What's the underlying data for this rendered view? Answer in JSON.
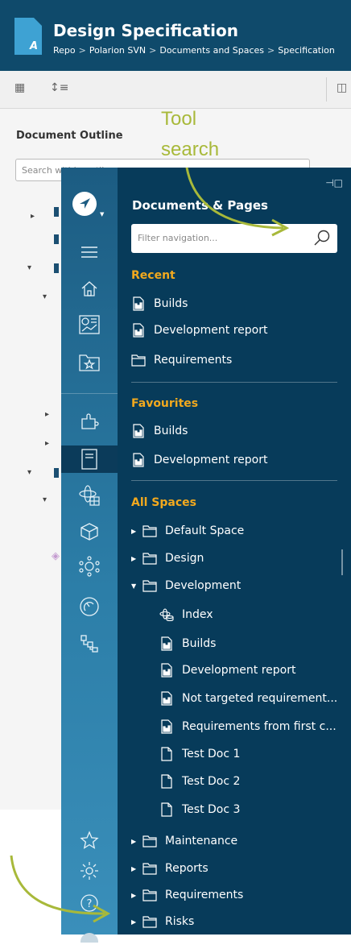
{
  "header": {
    "title": "Design Specification",
    "doc_badge": "A",
    "breadcrumb": [
      "Repo",
      "Polarion SVN",
      "Documents and Spaces",
      "Specification"
    ]
  },
  "outline": {
    "title": "Document Outline",
    "search_placeholder": "Search within outline"
  },
  "navigation": {
    "title": "Documents & Pages",
    "filter_placeholder": "Filter navigation...",
    "recent": {
      "label": "Recent",
      "items": [
        {
          "label": "Builds",
          "icon": "report-icon"
        },
        {
          "label": "Development report",
          "icon": "report-icon"
        },
        {
          "label": "Requirements",
          "icon": "folder-icon"
        }
      ]
    },
    "favourites": {
      "label": "Favourites",
      "items": [
        {
          "label": "Builds",
          "icon": "report-icon"
        },
        {
          "label": "Development report",
          "icon": "report-icon"
        }
      ]
    },
    "all_spaces": {
      "label": "All Spaces",
      "items": [
        {
          "label": "Default Space",
          "expanded": false
        },
        {
          "label": "Design",
          "expanded": false
        },
        {
          "label": "Development",
          "expanded": true
        },
        {
          "label": "Index",
          "icon": "index-icon"
        },
        {
          "label": "Builds",
          "icon": "report-icon"
        },
        {
          "label": "Development report",
          "icon": "report-icon"
        },
        {
          "label": "Not targeted requirement...",
          "icon": "report-icon"
        },
        {
          "label": "Requirements from first c...",
          "icon": "report-icon"
        },
        {
          "label": "Test Doc 1",
          "icon": "document-icon"
        },
        {
          "label": "Test Doc 2",
          "icon": "document-icon"
        },
        {
          "label": "Test Doc 3",
          "icon": "document-icon"
        },
        {
          "label": "Maintenance",
          "expanded": false
        },
        {
          "label": "Reports",
          "expanded": false
        },
        {
          "label": "Requirements",
          "expanded": false
        },
        {
          "label": "Risks",
          "expanded": false
        }
      ]
    }
  },
  "annotation": {
    "line1": "Tool",
    "line2": "search"
  },
  "colors": {
    "header_bg": "#0f4a6b",
    "panel_bg": "#073b5a",
    "strip_top": "#1c5c82",
    "section_accent": "#f2a91e",
    "annotation": "#a8b93a"
  }
}
